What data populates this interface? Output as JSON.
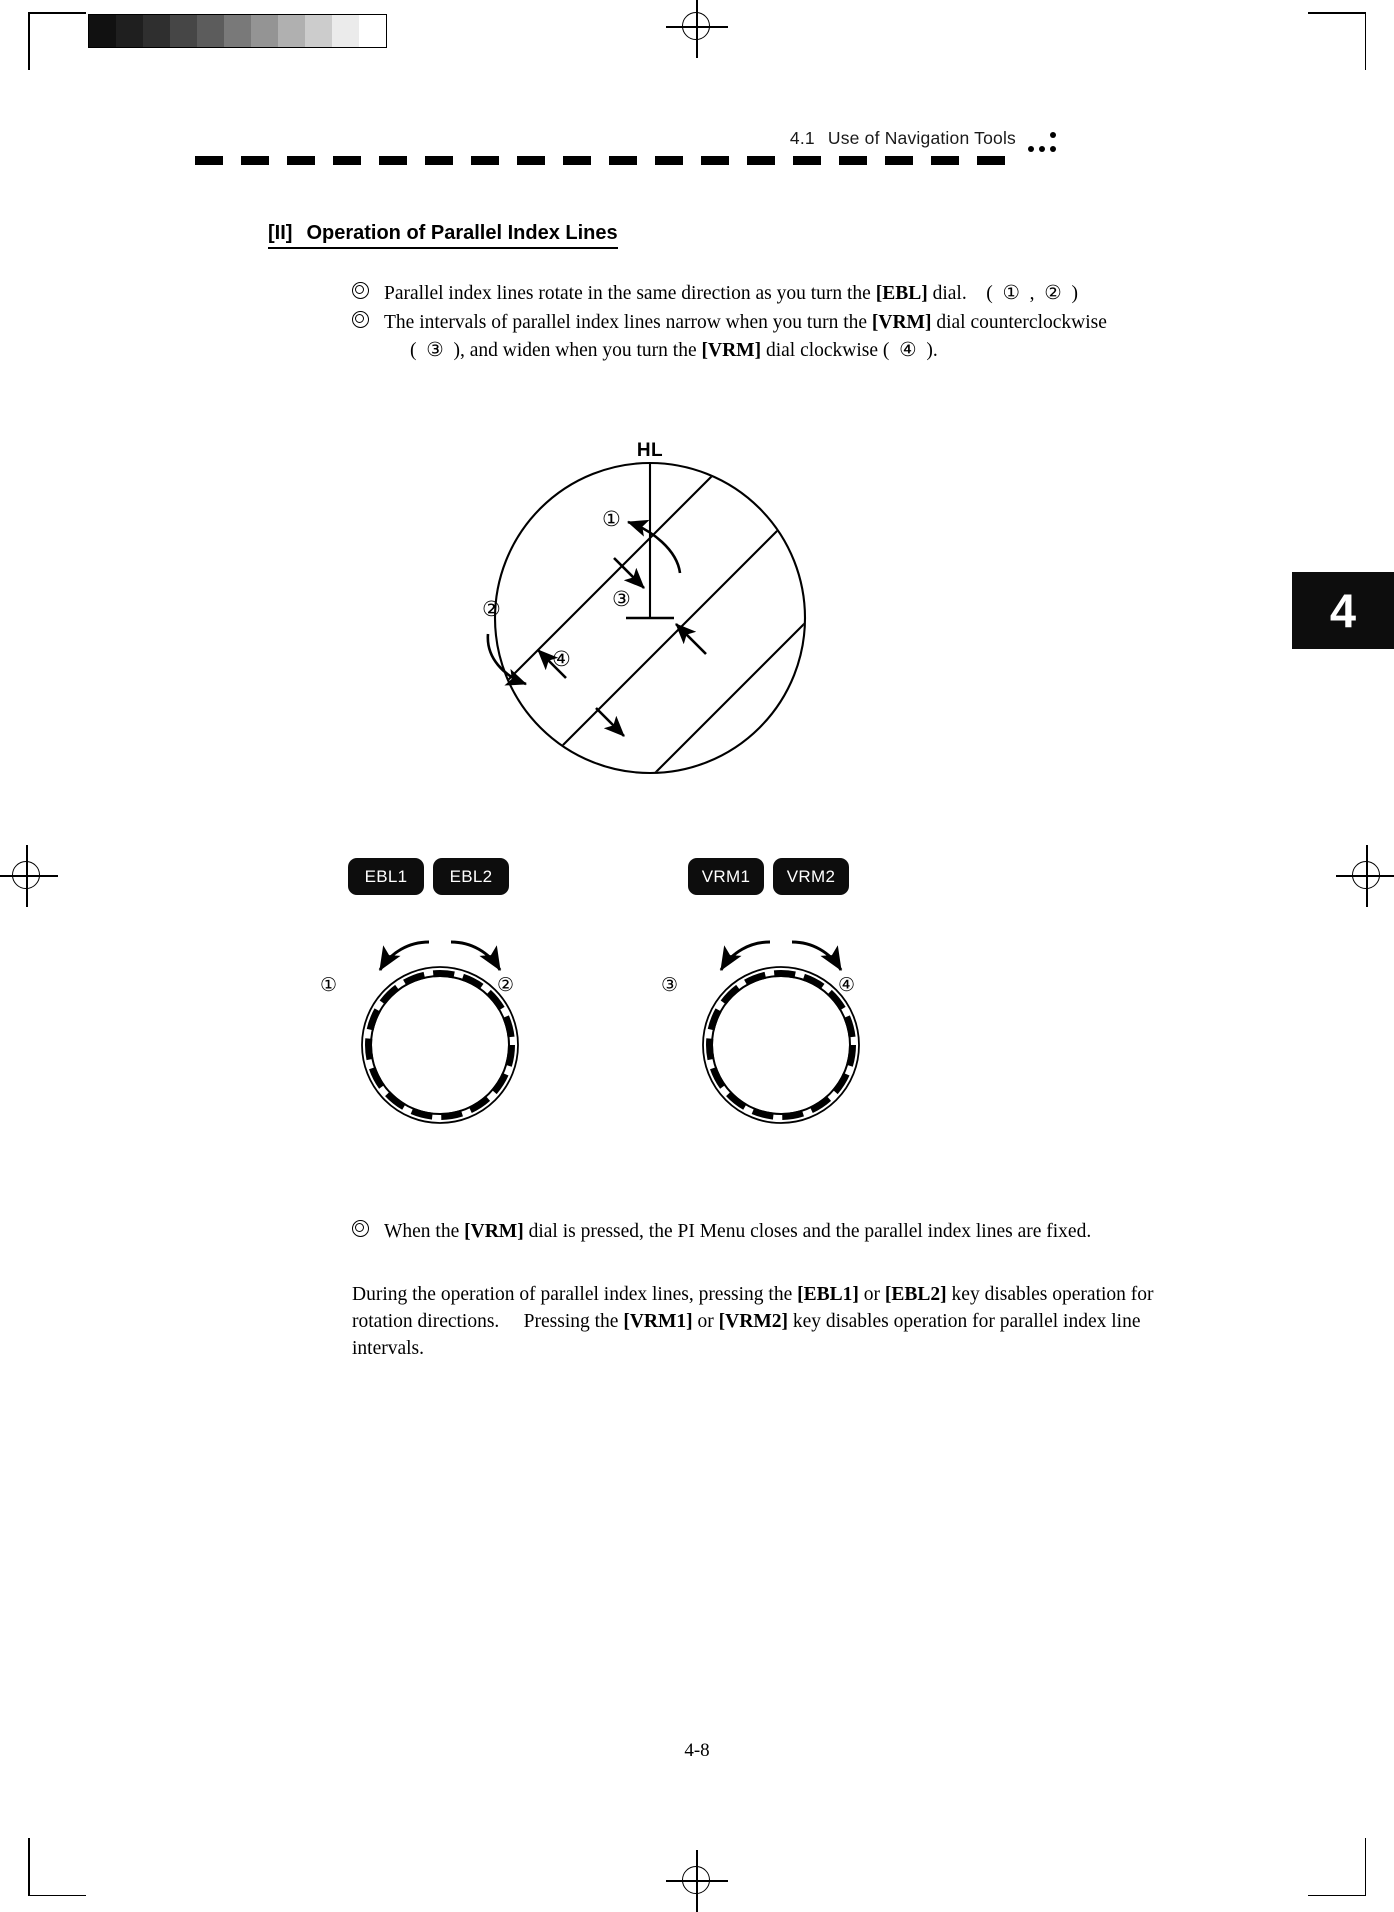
{
  "page": {
    "number": "4-8",
    "chapter_tab": "4"
  },
  "header": {
    "section_number": "4.1",
    "section_title": "Use of Navigation Tools",
    "dots_icon": "four-dot-marker"
  },
  "section": {
    "tag": "[II]",
    "title": "Operation of Parallel Index Lines"
  },
  "bullets": [
    {
      "marker": "double-circle-bullet",
      "segments": [
        {
          "text": "Parallel index lines rotate in the same direction as you turn the ",
          "bold": false
        },
        {
          "text": "[EBL]",
          "bold": true
        },
        {
          "text": " dial. ( ① , ② )",
          "bold": false
        }
      ]
    },
    {
      "marker": "double-circle-bullet",
      "segments": [
        {
          "text": "The intervals of parallel index lines narrow when you turn the ",
          "bold": false
        },
        {
          "text": "[VRM]",
          "bold": true
        },
        {
          "text": " dial counterclockwise",
          "bold": false
        }
      ],
      "continuation": [
        {
          "text": "( ③ ), and widen when you turn the ",
          "bold": false
        },
        {
          "text": "[VRM]",
          "bold": true
        },
        {
          "text": " dial clockwise ( ④ ).",
          "bold": false
        }
      ]
    }
  ],
  "diagram": {
    "hl_label": "HL",
    "callouts": [
      {
        "id": "1",
        "glyph": "①",
        "meaning": "rotate-counterclockwise"
      },
      {
        "id": "2",
        "glyph": "②",
        "meaning": "rotate-clockwise"
      },
      {
        "id": "3",
        "glyph": "③",
        "meaning": "narrow-interval"
      },
      {
        "id": "4",
        "glyph": "④",
        "meaning": "widen-interval"
      }
    ]
  },
  "controls": {
    "keys": [
      {
        "label": "EBL1",
        "name": "ebl1-key"
      },
      {
        "label": "EBL2",
        "name": "ebl2-key"
      },
      {
        "label": "VRM1",
        "name": "vrm1-key"
      },
      {
        "label": "VRM2",
        "name": "vrm2-key"
      }
    ],
    "dials": [
      {
        "name": "ebl-dial",
        "left_marker": "①",
        "right_marker": "②"
      },
      {
        "name": "vrm-dial",
        "left_marker": "③",
        "right_marker": "④"
      }
    ]
  },
  "note": {
    "marker": "double-circle-bullet",
    "segments": [
      {
        "text": "When the ",
        "bold": false
      },
      {
        "text": "[VRM]",
        "bold": true
      },
      {
        "text": " dial is pressed, the PI Menu closes and the parallel index lines are fixed.",
        "bold": false
      }
    ]
  },
  "paragraph": {
    "segments": [
      {
        "text": "During the operation of parallel index lines, pressing the ",
        "bold": false
      },
      {
        "text": "[EBL1]",
        "bold": true
      },
      {
        "text": " or ",
        "bold": false
      },
      {
        "text": "[EBL2]",
        "bold": true
      },
      {
        "text": " key disables operation for rotation directions.  Pressing the ",
        "bold": false
      },
      {
        "text": "[VRM1]",
        "bold": true
      },
      {
        "text": " or ",
        "bold": false
      },
      {
        "text": "[VRM2]",
        "bold": true
      },
      {
        "text": " key disables operation for parallel index line intervals.",
        "bold": false
      }
    ]
  },
  "calibration": {
    "name": "grayscale-step-wedge",
    "steps": [
      "#111111",
      "#1f1f1f",
      "#2f2f2f",
      "#464646",
      "#5c5c5c",
      "#797979",
      "#949494",
      "#b0b0b0",
      "#cccccc",
      "#ebebeb",
      "#ffffff"
    ]
  }
}
